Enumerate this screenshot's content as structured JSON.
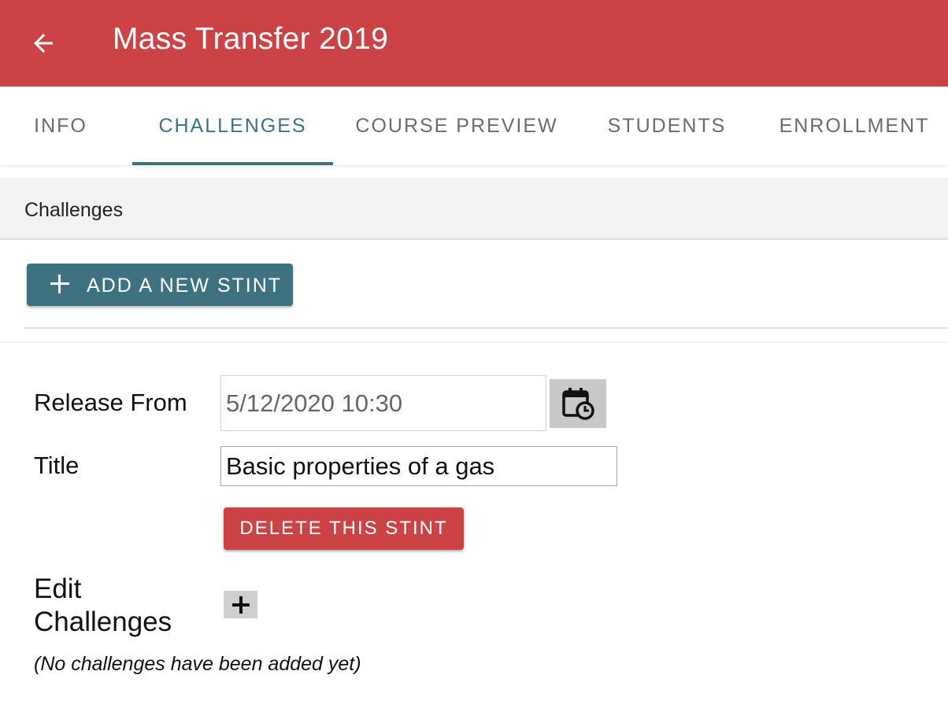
{
  "header": {
    "title": "Mass Transfer 2019",
    "back_icon": "arrow-left-icon",
    "color": "#cc4346"
  },
  "tabs": [
    {
      "label": "INFO",
      "active": false
    },
    {
      "label": "CHALLENGES",
      "active": true
    },
    {
      "label": "COURSE PREVIEW",
      "active": false
    },
    {
      "label": "STUDENTS",
      "active": false
    },
    {
      "label": "ENROLLMENT",
      "active": false
    }
  ],
  "section": {
    "title": "Challenges"
  },
  "toolbar": {
    "add_stint_label": "ADD A NEW STINT",
    "add_icon": "plus-icon",
    "accent": "#3e7280"
  },
  "stint": {
    "release_label": "Release From",
    "release_value": "5/12/2020 10:30",
    "calendar_icon": "calendar-clock-icon",
    "title_label": "Title",
    "title_value": "Basic properties of a gas",
    "delete_label": "DELETE THIS STINT",
    "edit_label": "Edit Challenges",
    "edit_add_icon": "plus-icon",
    "empty_note": "(No challenges have been added yet)"
  }
}
